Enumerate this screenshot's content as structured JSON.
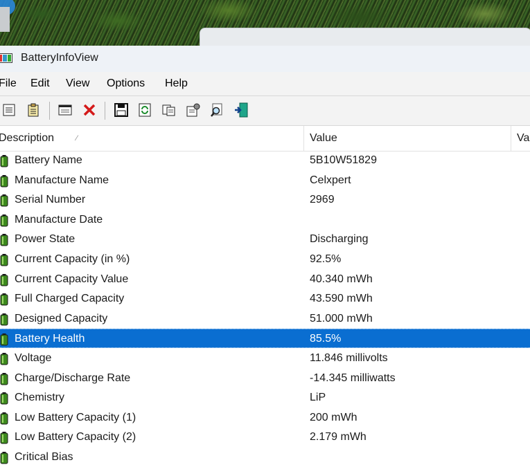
{
  "window": {
    "title": "BatteryInfoView"
  },
  "menu": [
    "File",
    "Edit",
    "View",
    "Options",
    "Help"
  ],
  "toolbar": [
    "properties-icon",
    "html-report-icon",
    "window-icon",
    "delete-icon",
    "save-icon",
    "refresh-icon",
    "copy-icon",
    "options-icon",
    "find-icon",
    "exit-icon"
  ],
  "columns": [
    "Description",
    "Value",
    "Va"
  ],
  "rows": [
    {
      "desc": "Battery Name",
      "value": "5B10W51829"
    },
    {
      "desc": "Manufacture Name",
      "value": "Celxpert"
    },
    {
      "desc": "Serial Number",
      "value": " 2969"
    },
    {
      "desc": "Manufacture Date",
      "value": ""
    },
    {
      "desc": "Power State",
      "value": "Discharging"
    },
    {
      "desc": "Current Capacity (in %)",
      "value": "92.5%"
    },
    {
      "desc": "Current Capacity Value",
      "value": "40.340 mWh"
    },
    {
      "desc": "Full Charged Capacity",
      "value": "43.590 mWh"
    },
    {
      "desc": "Designed Capacity",
      "value": "51.000 mWh"
    },
    {
      "desc": "Battery Health",
      "value": "85.5%",
      "selected": true
    },
    {
      "desc": "Voltage",
      "value": "11.846 millivolts"
    },
    {
      "desc": "Charge/Discharge Rate",
      "value": "-14.345 milliwatts"
    },
    {
      "desc": "Chemistry",
      "value": "LiP"
    },
    {
      "desc": "Low Battery Capacity (1)",
      "value": "200 mWh"
    },
    {
      "desc": "Low Battery Capacity (2)",
      "value": "2.179 mWh"
    },
    {
      "desc": "Critical Bias",
      "value": ""
    }
  ],
  "colors": {
    "selection": "#0a6ed1",
    "battery_green": "#3d8a1e"
  }
}
